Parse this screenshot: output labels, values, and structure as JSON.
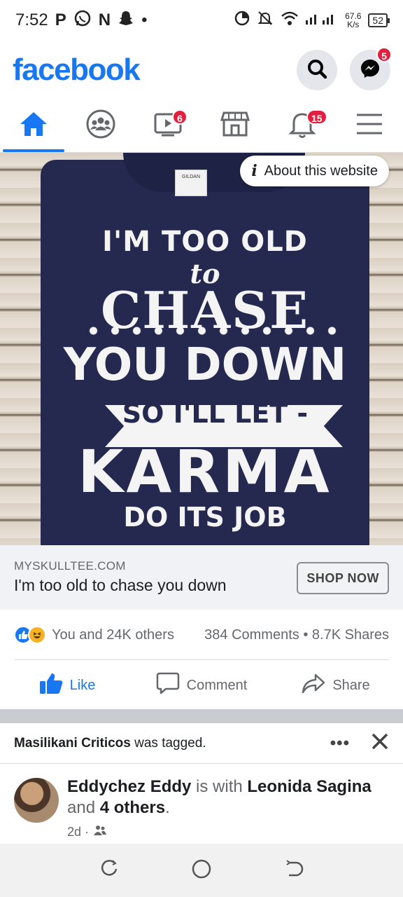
{
  "status_bar": {
    "time": "7:52",
    "left_glyphs": [
      "P",
      "whatsapp-icon",
      "N",
      "snapchat-icon",
      "•"
    ],
    "speed_value": "67.6",
    "speed_unit": "K/s",
    "battery": "52"
  },
  "header": {
    "logo": "facebook",
    "messenger_badge": "5"
  },
  "nav": {
    "tabs": [
      {
        "name": "home",
        "badge": ""
      },
      {
        "name": "groups",
        "badge": ""
      },
      {
        "name": "watch",
        "badge": "6"
      },
      {
        "name": "marketplace",
        "badge": ""
      },
      {
        "name": "notifications",
        "badge": "15"
      },
      {
        "name": "menu",
        "badge": ""
      }
    ]
  },
  "ad": {
    "about_label": "About this website",
    "shirt_lines": [
      "I'M TOO OLD",
      "to",
      "CHASE",
      "YOU DOWN",
      "- SO I'LL LET -",
      "KARMA",
      "DO ITS JOB"
    ],
    "domain": "MYSKULLTEE.COM",
    "title": "I'm too old to chase you down",
    "cta": "SHOP NOW"
  },
  "engagement": {
    "reactions_text": "You and 24K others",
    "comments": "384 Comments",
    "dot": "•",
    "shares": "8.7K Shares"
  },
  "actions": {
    "like": "Like",
    "comment": "Comment",
    "share": "Share"
  },
  "next_post": {
    "tagged_name": "Masilikani Criticos",
    "tagged_suffix": " was tagged.",
    "more": "•••",
    "author": "Eddychez Eddy",
    "with_text": " is with ",
    "with_name": "Leonida Sagina",
    "and_text": "and ",
    "others": "4 others",
    "period": ".",
    "time": "2d ·"
  },
  "colors": {
    "brand": "#1877f2",
    "badge": "#e41e3f"
  }
}
